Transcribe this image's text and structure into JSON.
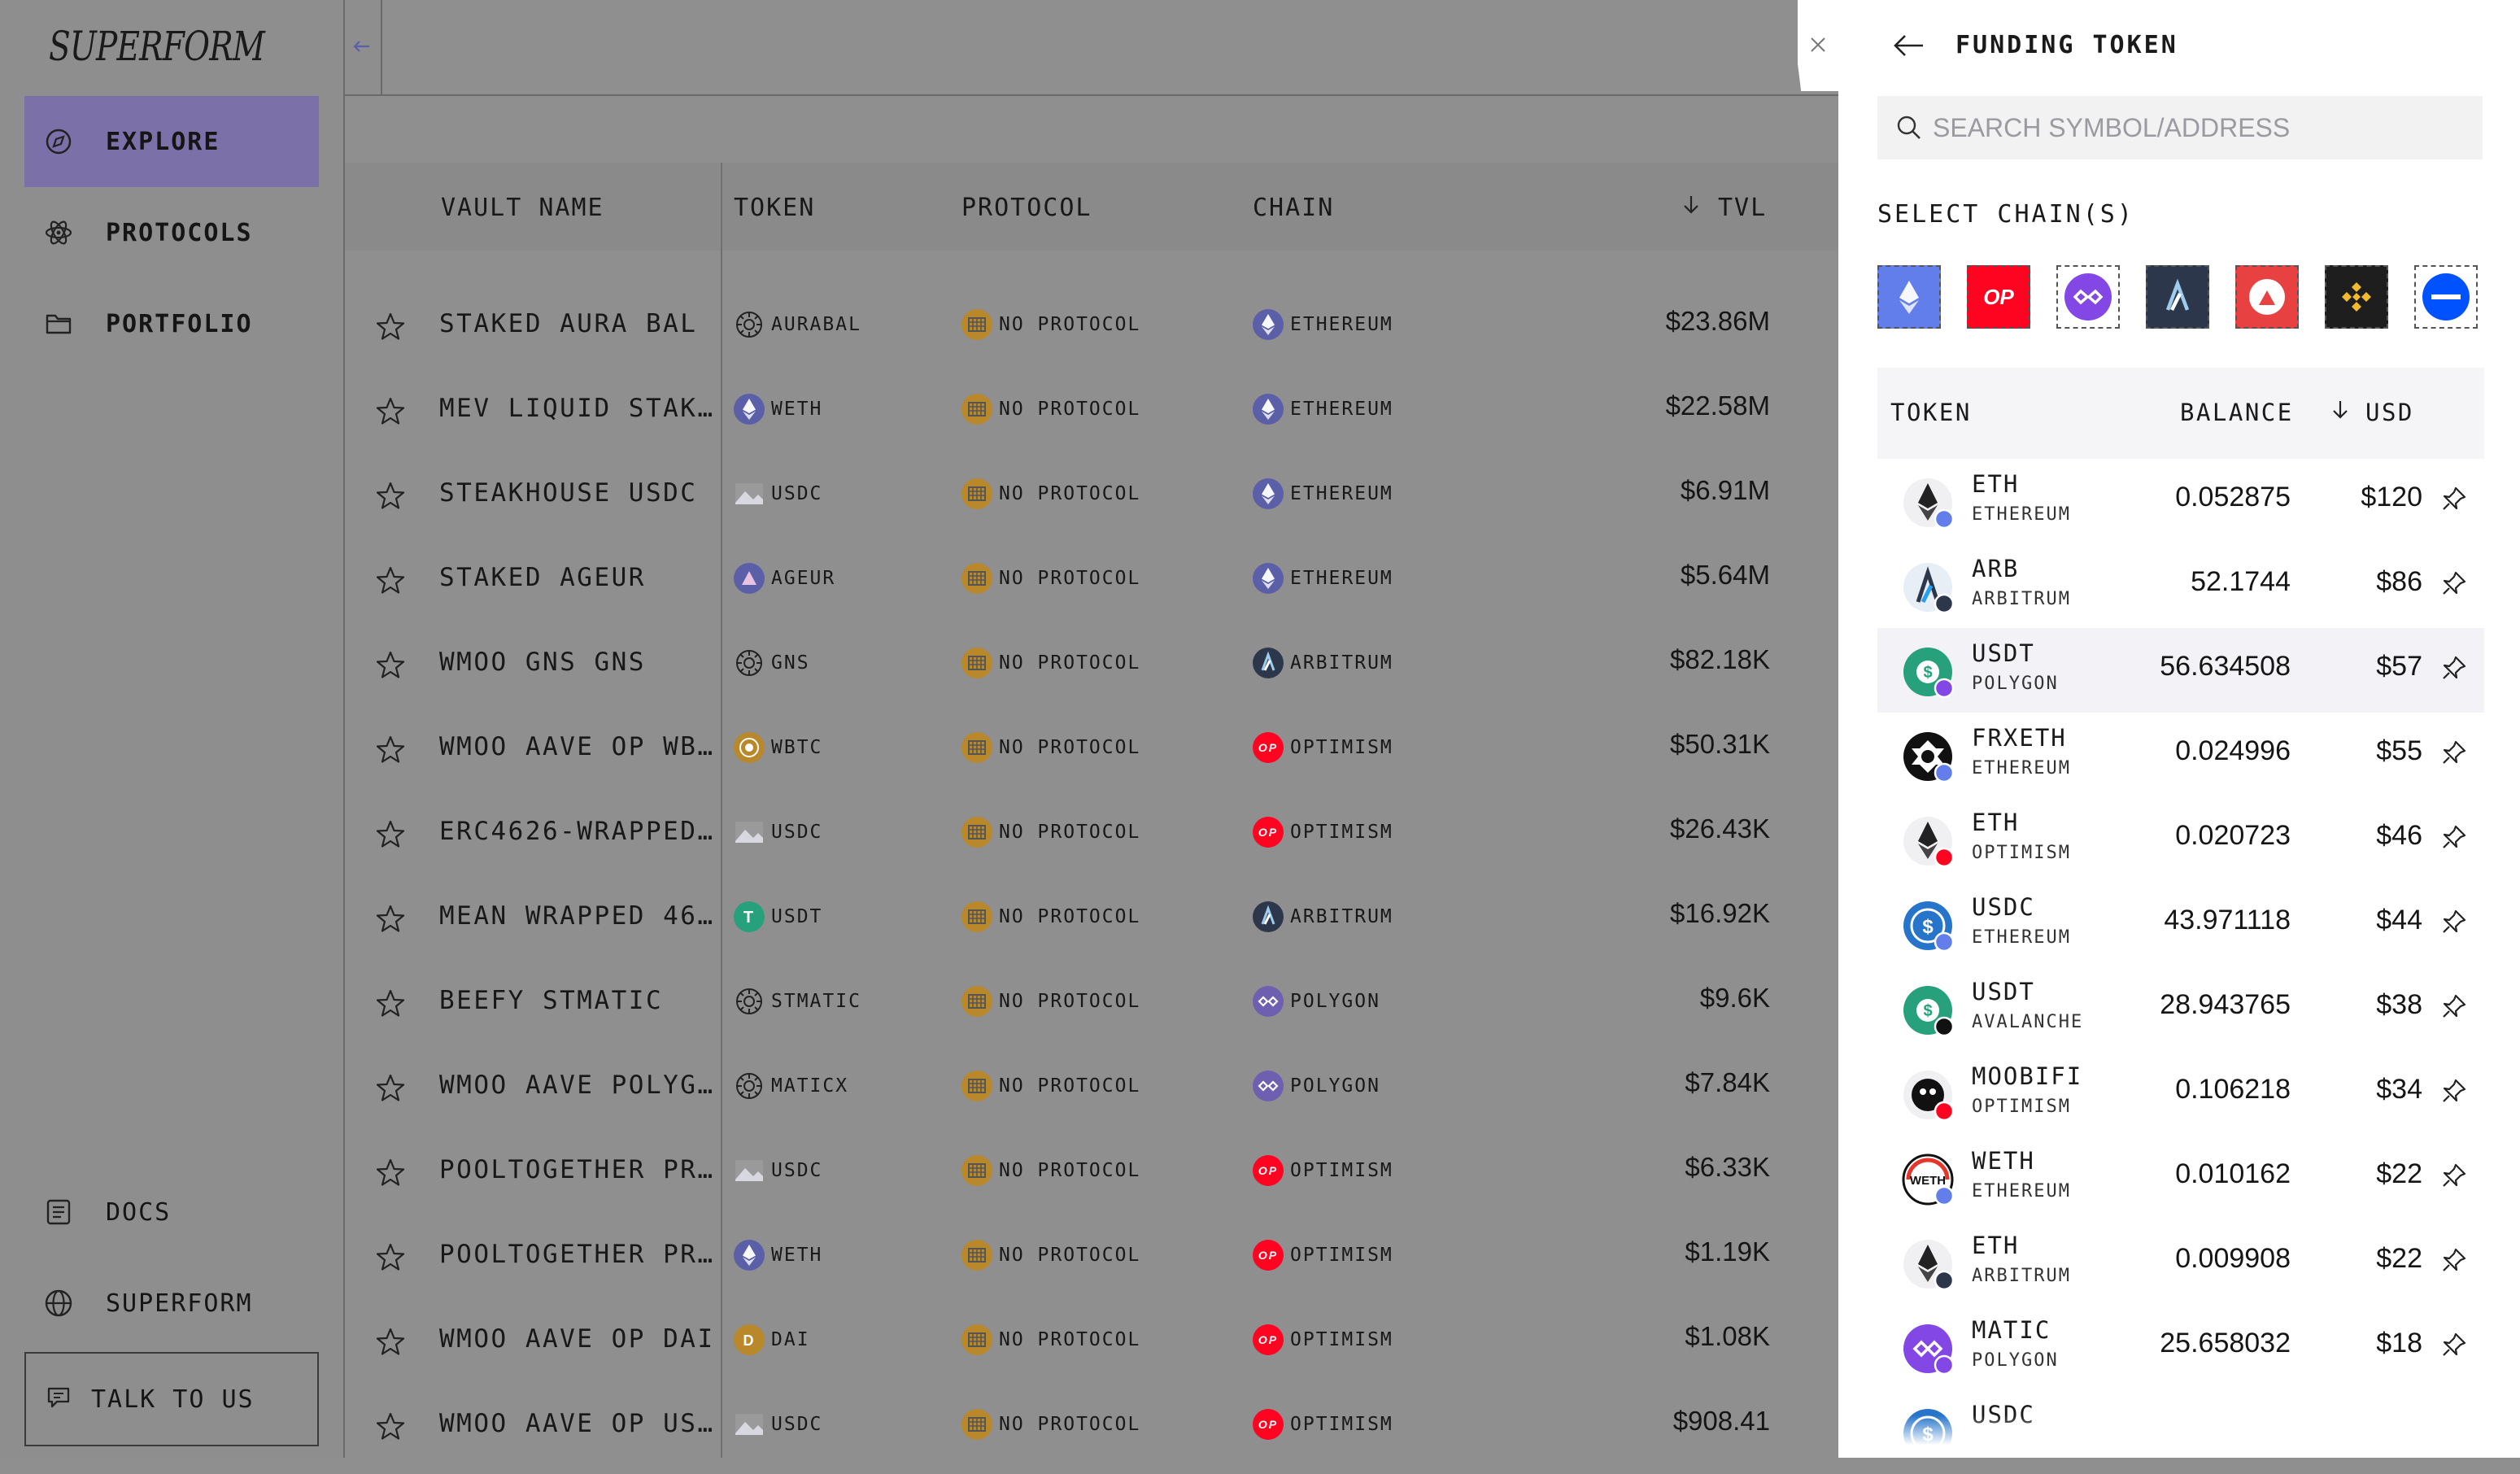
{
  "brand": {
    "logo": "SUPERFORM"
  },
  "sidebar": {
    "nav": [
      {
        "label": "EXPLORE",
        "icon": "compass-icon",
        "active": true
      },
      {
        "label": "PROTOCOLS",
        "icon": "atom-icon",
        "active": false
      },
      {
        "label": "PORTFOLIO",
        "icon": "folder-icon",
        "active": false
      }
    ],
    "footer": [
      {
        "label": "DOCS",
        "icon": "document-icon"
      },
      {
        "label": "SUPERFORM",
        "icon": "globe-icon"
      }
    ],
    "talk_label": "TALK TO US"
  },
  "table": {
    "headers": {
      "vault": "VAULT NAME",
      "token": "TOKEN",
      "protocol": "PROTOCOL",
      "chain": "CHAIN",
      "tvl": "TVL"
    },
    "rows": [
      {
        "name": "STAKED AURA BAL",
        "token": "AURABAL",
        "protocol": "NO PROTOCOL",
        "chain": "ETHEREUM",
        "tvl": "$23.86M"
      },
      {
        "name": "MEV LIQUID STAK…",
        "token": "WETH",
        "protocol": "NO PROTOCOL",
        "chain": "ETHEREUM",
        "tvl": "$22.58M"
      },
      {
        "name": "STEAKHOUSE USDC",
        "token": "USDC",
        "protocol": "NO PROTOCOL",
        "chain": "ETHEREUM",
        "tvl": "$6.91M"
      },
      {
        "name": "STAKED AGEUR",
        "token": "AGEUR",
        "protocol": "NO PROTOCOL",
        "chain": "ETHEREUM",
        "tvl": "$5.64M"
      },
      {
        "name": "WMOO GNS GNS",
        "token": "GNS",
        "protocol": "NO PROTOCOL",
        "chain": "ARBITRUM",
        "tvl": "$82.18K"
      },
      {
        "name": "WMOO AAVE OP WB…",
        "token": "WBTC",
        "protocol": "NO PROTOCOL",
        "chain": "OPTIMISM",
        "tvl": "$50.31K"
      },
      {
        "name": "ERC4626-WRAPPED…",
        "token": "USDC",
        "protocol": "NO PROTOCOL",
        "chain": "OPTIMISM",
        "tvl": "$26.43K"
      },
      {
        "name": "MEAN WRAPPED 46…",
        "token": "USDT",
        "protocol": "NO PROTOCOL",
        "chain": "ARBITRUM",
        "tvl": "$16.92K"
      },
      {
        "name": "BEEFY STMATIC",
        "token": "STMATIC",
        "protocol": "NO PROTOCOL",
        "chain": "POLYGON",
        "tvl": "$9.6K"
      },
      {
        "name": "WMOO AAVE POLYG…",
        "token": "MATICX",
        "protocol": "NO PROTOCOL",
        "chain": "POLYGON",
        "tvl": "$7.84K"
      },
      {
        "name": "POOLTOGETHER PR…",
        "token": "USDC",
        "protocol": "NO PROTOCOL",
        "chain": "OPTIMISM",
        "tvl": "$6.33K"
      },
      {
        "name": "POOLTOGETHER PR…",
        "token": "WETH",
        "protocol": "NO PROTOCOL",
        "chain": "OPTIMISM",
        "tvl": "$1.19K"
      },
      {
        "name": "WMOO AAVE OP DAI",
        "token": "DAI",
        "protocol": "NO PROTOCOL",
        "chain": "OPTIMISM",
        "tvl": "$1.08K"
      },
      {
        "name": "WMOO AAVE OP US…",
        "token": "USDC",
        "protocol": "NO PROTOCOL",
        "chain": "OPTIMISM",
        "tvl": "$908.41"
      }
    ]
  },
  "panel": {
    "title": "FUNDING TOKEN",
    "search_placeholder": "SEARCH SYMBOL/ADDRESS",
    "chains_label": "SELECT CHAIN(S)",
    "chains": [
      {
        "name": "ethereum-chain-button",
        "color": "#627eea"
      },
      {
        "name": "optimism-chain-button",
        "color": "#ff0420",
        "text": "OP"
      },
      {
        "name": "polygon-chain-button",
        "color": "#8247e5"
      },
      {
        "name": "arbitrum-chain-button",
        "color": "#2d374b"
      },
      {
        "name": "avalanche-chain-button",
        "color": "#e84142"
      },
      {
        "name": "bnb-chain-button",
        "color": "#1e1e1e"
      },
      {
        "name": "base-chain-button",
        "color": "#0052ff"
      }
    ],
    "headers": {
      "token": "TOKEN",
      "balance": "BALANCE",
      "usd": "USD"
    },
    "tokens": [
      {
        "symbol": "ETH",
        "chain": "ETHEREUM",
        "balance": "0.052875",
        "usd": "$120"
      },
      {
        "symbol": "ARB",
        "chain": "ARBITRUM",
        "balance": "52.1744",
        "usd": "$86"
      },
      {
        "symbol": "USDT",
        "chain": "POLYGON",
        "balance": "56.634508",
        "usd": "$57"
      },
      {
        "symbol": "FRXETH",
        "chain": "ETHEREUM",
        "balance": "0.024996",
        "usd": "$55"
      },
      {
        "symbol": "ETH",
        "chain": "OPTIMISM",
        "balance": "0.020723",
        "usd": "$46"
      },
      {
        "symbol": "USDC",
        "chain": "ETHEREUM",
        "balance": "43.971118",
        "usd": "$44"
      },
      {
        "symbol": "USDT",
        "chain": "AVALANCHE",
        "balance": "28.943765",
        "usd": "$38"
      },
      {
        "symbol": "MOOBIFI",
        "chain": "OPTIMISM",
        "balance": "0.106218",
        "usd": "$34"
      },
      {
        "symbol": "WETH",
        "chain": "ETHEREUM",
        "balance": "0.010162",
        "usd": "$22"
      },
      {
        "symbol": "ETH",
        "chain": "ARBITRUM",
        "balance": "0.009908",
        "usd": "$22"
      },
      {
        "symbol": "MATIC",
        "chain": "POLYGON",
        "balance": "25.658032",
        "usd": "$18"
      },
      {
        "symbol": "USDC",
        "chain": "",
        "balance": "",
        "usd": ""
      }
    ]
  },
  "colors": {
    "overlay": "#8f8f8f",
    "active_nav": "#7c70a8",
    "ethereum": "#627eea",
    "optimism": "#ff0420",
    "polygon": "#8247e5",
    "arbitrum": "#2d374b",
    "tether": "#26a17b",
    "usdc": "#2775ca"
  }
}
